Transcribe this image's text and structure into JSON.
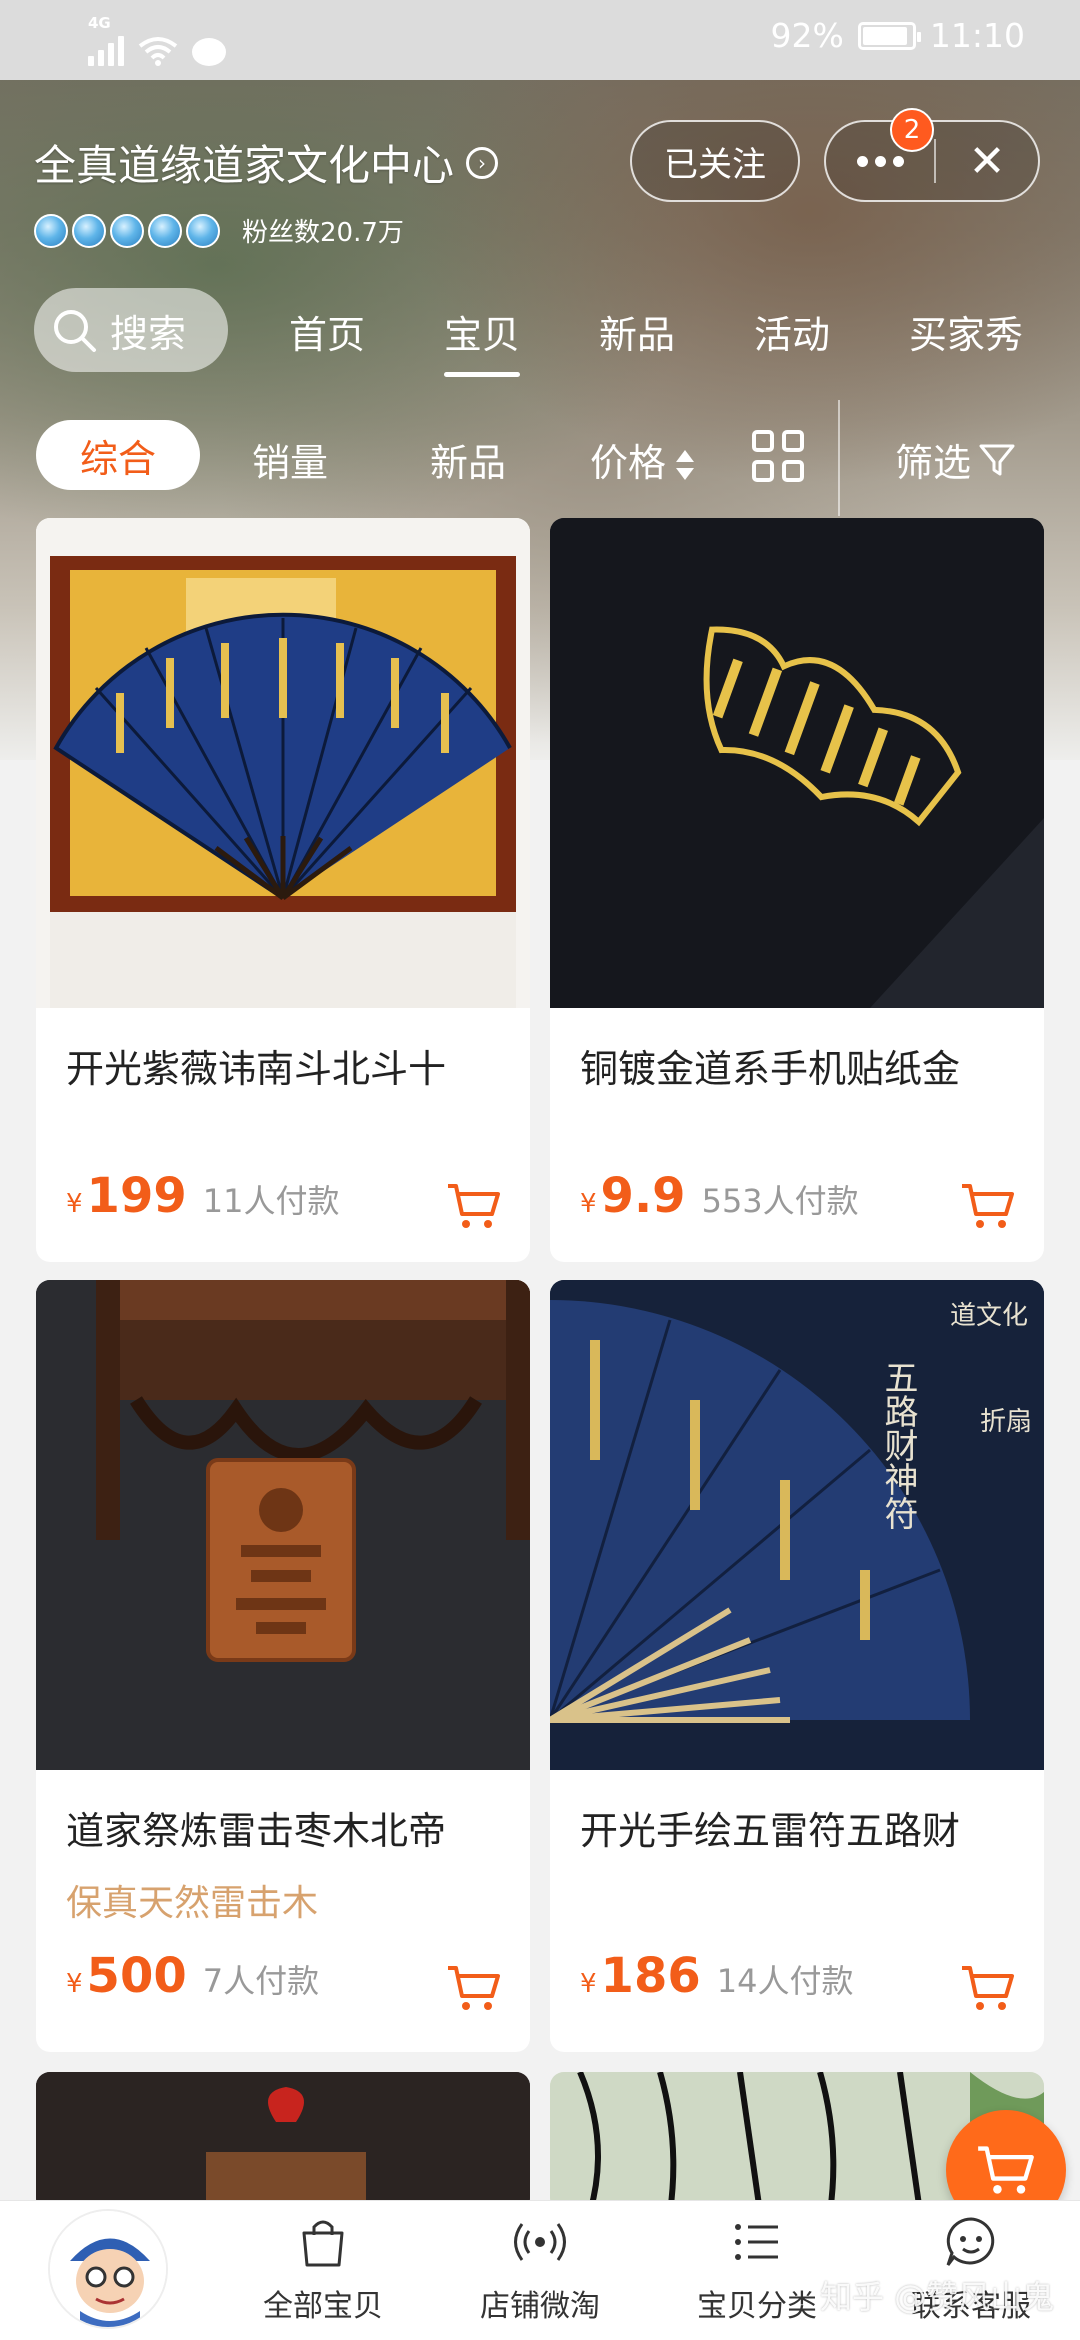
{
  "status_bar": {
    "network": "4G",
    "battery": "92%",
    "time": "11:10",
    "battery_level": 0.92
  },
  "store": {
    "name": "全真道缘道家文化中心",
    "fans": "粉丝数20.7万",
    "crown_count": 5,
    "follow_label": "已关注",
    "notification_count": "2"
  },
  "nav_tabs": [
    {
      "label": "搜索"
    },
    {
      "label": "首页"
    },
    {
      "label": "宝贝",
      "active": true
    },
    {
      "label": "新品"
    },
    {
      "label": "活动"
    },
    {
      "label": "买家秀"
    }
  ],
  "sort": {
    "comprehensive": "综合",
    "sales": "销量",
    "new": "新品",
    "price": "价格",
    "filter": "筛选"
  },
  "products": [
    {
      "title": "开光紫薇讳南斗北斗十",
      "subtitle": "",
      "currency": "¥",
      "price": "199",
      "sold": "11人付款"
    },
    {
      "title": "铜镀金道系手机贴纸金",
      "subtitle": "",
      "currency": "¥",
      "price": "9.9",
      "sold": "553人付款"
    },
    {
      "title": "道家祭炼雷击枣木北帝",
      "subtitle": "保真天然雷击木",
      "currency": "¥",
      "price": "500",
      "sold": "7人付款"
    },
    {
      "title": "开光手绘五雷符五路财",
      "subtitle": "",
      "currency": "¥",
      "price": "186",
      "sold": "14人付款"
    }
  ],
  "fan_art_text": {
    "line1": "道文化",
    "line2": "五路财神符",
    "line3": "折扇"
  },
  "bottom_bar": {
    "items": [
      {
        "label": "全部宝贝",
        "icon": "shopping-bag-icon"
      },
      {
        "label": "店铺微淘",
        "icon": "broadcast-icon"
      },
      {
        "label": "宝贝分类",
        "icon": "list-icon"
      },
      {
        "label": "联系客服",
        "icon": "chat-face-icon"
      }
    ],
    "watermark": "知乎 @赞风山鬼"
  },
  "colors": {
    "accent": "#f25d19",
    "badge": "#ff5a1f",
    "subtitle": "#d7a26e"
  }
}
